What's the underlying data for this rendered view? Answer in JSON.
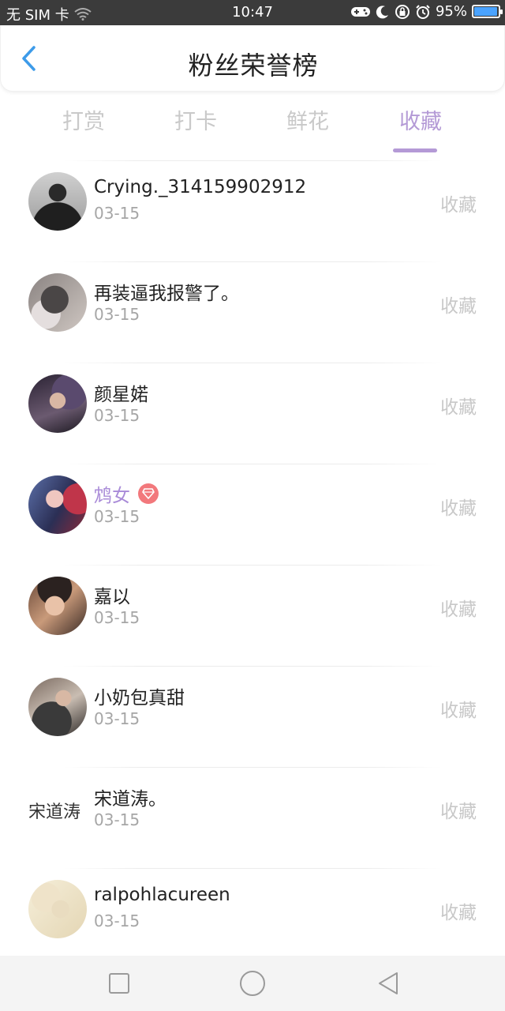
{
  "status_bar": {
    "carrier": "无 SIM 卡",
    "time": "10:47",
    "battery_percent": "95%",
    "battery_level": 0.95,
    "icons": [
      "wifi-icon",
      "gamepad-icon",
      "moon-icon",
      "lock-rotation-icon",
      "alarm-icon",
      "battery-icon"
    ]
  },
  "header": {
    "title": "粉丝荣誉榜",
    "back_icon": "chevron-left-icon"
  },
  "tabs": [
    {
      "label": "打赏",
      "active": false
    },
    {
      "label": "打卡",
      "active": false
    },
    {
      "label": "鲜花",
      "active": false
    },
    {
      "label": "收藏",
      "active": true
    }
  ],
  "colors": {
    "accent": "#b49ad6",
    "vip_name": "#a98bd8",
    "vip_badge": "#f2787c",
    "back_arrow": "#3d9be9"
  },
  "fans": [
    {
      "name": "Crying._314159902912",
      "date": "03-15",
      "action": "收藏",
      "avatar": "photo"
    },
    {
      "name": "再装逼我报警了。",
      "date": "03-15",
      "action": "收藏",
      "avatar": "photo"
    },
    {
      "name": "颜星婼",
      "date": "03-15",
      "action": "收藏",
      "avatar": "photo"
    },
    {
      "name": "鸩女",
      "date": "03-15",
      "action": "收藏",
      "avatar": "photo",
      "vip": true
    },
    {
      "name": "嘉以",
      "date": "03-15",
      "action": "收藏",
      "avatar": "photo"
    },
    {
      "name": "小奶包真甜",
      "date": "03-15",
      "action": "收藏",
      "avatar": "photo"
    },
    {
      "name": "宋道涛。",
      "date": "03-15",
      "action": "收藏",
      "avatar_text": "宋道涛"
    },
    {
      "name": "ralpohlacureen",
      "date": "03-15",
      "action": "收藏",
      "avatar": "photo"
    }
  ],
  "nav_bar": {
    "icons": [
      "square-recents-icon",
      "circle-home-icon",
      "triangle-back-icon"
    ]
  }
}
